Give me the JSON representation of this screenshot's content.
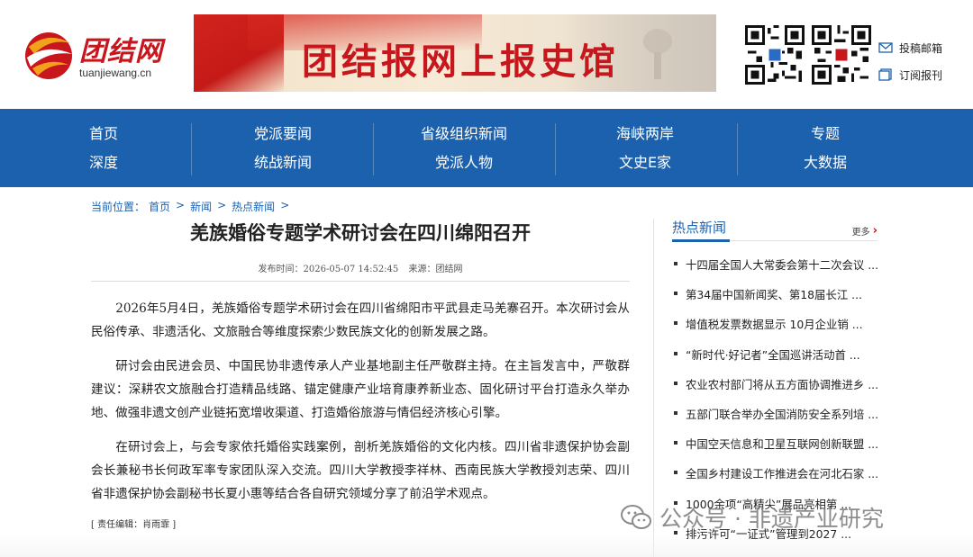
{
  "header": {
    "logo_cn": "团结网",
    "logo_en": "tuanjiewang.cn",
    "banner_text": "团结报网上报史馆",
    "links": [
      {
        "label": "投稿邮箱",
        "icon": "mail-icon"
      },
      {
        "label": "订阅报刊",
        "icon": "subscribe-icon"
      }
    ]
  },
  "nav": {
    "row1": [
      "首页",
      "党派要闻",
      "省级组织新闻",
      "海峡两岸",
      "专题"
    ],
    "row2": [
      "深度",
      "统战新闻",
      "党派人物",
      "文史E家",
      "大数据"
    ]
  },
  "breadcrumb": {
    "prefix": "当前位置：",
    "items": [
      "首页",
      "新闻",
      "热点新闻"
    ],
    "sep": ">"
  },
  "article": {
    "title": "羌族婚俗专题学术研讨会在四川绵阳召开",
    "publish_label": "发布时间：2026-05-07 14:52:45",
    "source_label": "来源：团结网",
    "paragraphs": [
      "2026年5月4日，羌族婚俗专题学术研讨会在四川省绵阳市平武县走马羌寨召开。本次研讨会从民俗传承、非遗活化、文旅融合等维度探索少数民族文化的创新发展之路。",
      "研讨会由民进会员、中国民协非遗传承人产业基地副主任严敬群主持。在主旨发言中，严敬群建议：深耕农文旅融合打造精品线路、锚定健康产业培育康养新业态、固化研讨平台打造永久举办地、做强非遗文创产业链拓宽增收渠道、打造婚俗旅游与情侣经济核心引擎。",
      "在研讨会上，与会专家依托婚俗实践案例，剖析羌族婚俗的文化内核。四川省非遗保护协会副会长兼秘书长何政军率专家团队深入交流。四川大学教授李祥林、西南民族大学教授刘志荣、四川省非遗保护协会副秘书长夏小惠等结合各自研究领域分享了前沿学术观点。"
    ],
    "editor": "[ 责任编辑：肖雨霏 ]"
  },
  "sidebar": {
    "title": "热点新闻",
    "more": "更多",
    "items": [
      "十四届全国人大常委会第十二次会议 ...",
      "第34届中国新闻奖、第18届长江 ...",
      "增值税发票数据显示 10月企业销 ...",
      "“新时代·好记者”全国巡讲活动首 ...",
      "农业农村部门将从五方面协调推进乡 ...",
      "五部门联合举办全国消防安全系列培 ...",
      "中国空天信息和卫星互联网创新联盟 ...",
      "全国乡村建设工作推进会在河北石家 ...",
      "1000余项“高精尖”展品亮相第 ...",
      "排污许可“一证式”管理到2027 ..."
    ]
  },
  "watermark": {
    "text": "公众号 · 非遗产业研究",
    "icon": "wechat-icon"
  },
  "colors": {
    "brand_red": "#c8161d",
    "nav_blue": "#1c61ad"
  }
}
